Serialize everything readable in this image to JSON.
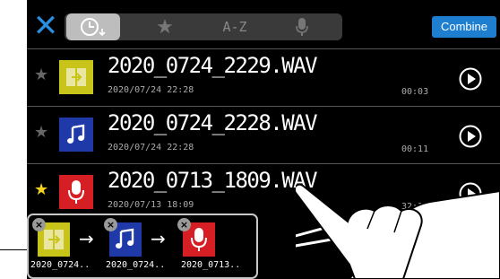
{
  "toolbar": {
    "close_icon": "close-icon",
    "tabs": [
      {
        "label": "",
        "icon": "clock-sort-icon",
        "active": true
      },
      {
        "label": "",
        "icon": "star-icon",
        "active": false
      },
      {
        "label": "A-Z",
        "icon": "",
        "active": false
      },
      {
        "label": "",
        "icon": "mic-icon",
        "active": false
      }
    ],
    "combine_label": "Combine"
  },
  "files": [
    {
      "name": "2020_0724_2229.WAV",
      "date": "2020/07/24 22:28",
      "duration": "00:03",
      "favorite": false,
      "icon": "import-icon",
      "icon_color": "#c8c41a"
    },
    {
      "name": "2020_0724_2228.WAV",
      "date": "2020/07/24 22:28",
      "duration": "00:11",
      "favorite": false,
      "icon": "music-note-icon",
      "icon_color": "#1f3aa8"
    },
    {
      "name": "2020_0713_1809.WAV",
      "date": "2020/07/13 18:09",
      "duration": "32:10",
      "favorite": true,
      "icon": "mic-icon",
      "icon_color": "#d61f24"
    }
  ],
  "tray": {
    "items": [
      {
        "label": "2020_0724..",
        "icon": "import-icon"
      },
      {
        "label": "2020_0724..",
        "icon": "music-note-icon"
      },
      {
        "label": "2020_0713..",
        "icon": "mic-icon"
      }
    ],
    "arrow": "→"
  },
  "colors": {
    "accent": "#1e7fd1",
    "favorite": "#f4d21a"
  }
}
